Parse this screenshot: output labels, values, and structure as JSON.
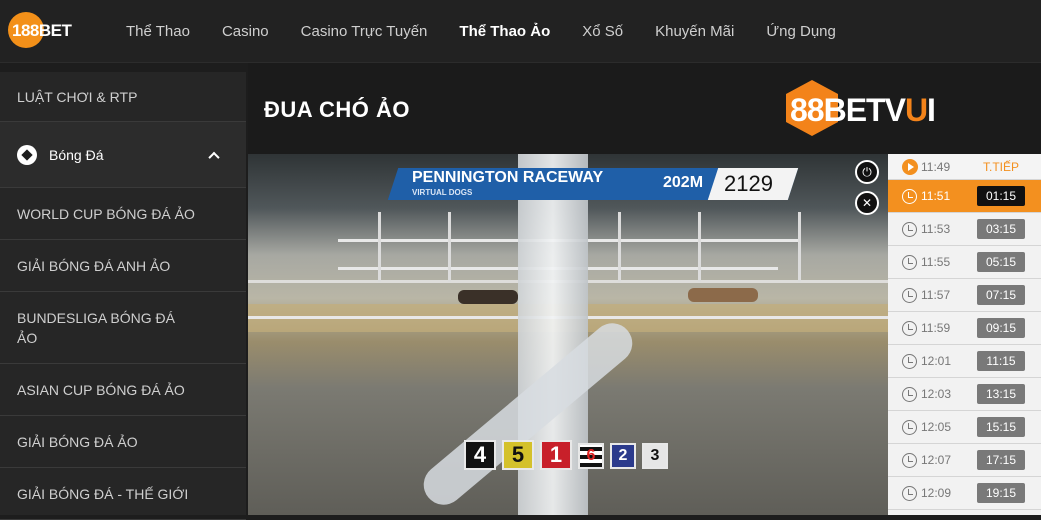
{
  "header": {
    "logo_text": "188BET",
    "nav": [
      "Thể Thao",
      "Casino",
      "Casino Trực Tuyến",
      "Thể Thao Ảo",
      "Xổ Số",
      "Khuyến Mãi",
      "Ứng Dụng"
    ],
    "active_nav": "Thể Thao Ảo"
  },
  "sidebar": {
    "top": "LUẬT CHƠI & RTP",
    "section": "Bóng Đá",
    "items": [
      "WORLD CUP BÓNG ĐÁ ẢO",
      "GIẢI BÓNG ĐÁ ANH ẢO",
      "BUNDESLIGA BÓNG ĐÁ ẢO",
      "ASIAN CUP BÓNG ĐÁ ẢO",
      "GIẢI BÓNG ĐÁ ẢO",
      "GIẢI BÓNG ĐÁ - THẾ GIỚI"
    ]
  },
  "main": {
    "title": "ĐUA CHÓ ẢO",
    "brand": {
      "part1": "88BETV",
      "part2": "U",
      "part3": "I"
    }
  },
  "video": {
    "track_name": "PENNINGTON RACEWAY",
    "subtitle": "VIRTUAL DOGS",
    "distance": "202M",
    "race_id": "2129",
    "positions": [
      "4",
      "5",
      "1",
      "6",
      "2",
      "3"
    ]
  },
  "schedule": {
    "next_time": "11:49",
    "next_label": "T.TIẾP",
    "rows": [
      {
        "time": "11:51",
        "countdown": "01:15",
        "active": true
      },
      {
        "time": "11:53",
        "countdown": "03:15"
      },
      {
        "time": "11:55",
        "countdown": "05:15"
      },
      {
        "time": "11:57",
        "countdown": "07:15"
      },
      {
        "time": "11:59",
        "countdown": "09:15"
      },
      {
        "time": "12:01",
        "countdown": "11:15"
      },
      {
        "time": "12:03",
        "countdown": "13:15"
      },
      {
        "time": "12:05",
        "countdown": "15:15"
      },
      {
        "time": "12:07",
        "countdown": "17:15"
      },
      {
        "time": "12:09",
        "countdown": "19:15"
      }
    ]
  },
  "colors": {
    "accent": "#f3901f",
    "banner": "#1f5fa8"
  }
}
